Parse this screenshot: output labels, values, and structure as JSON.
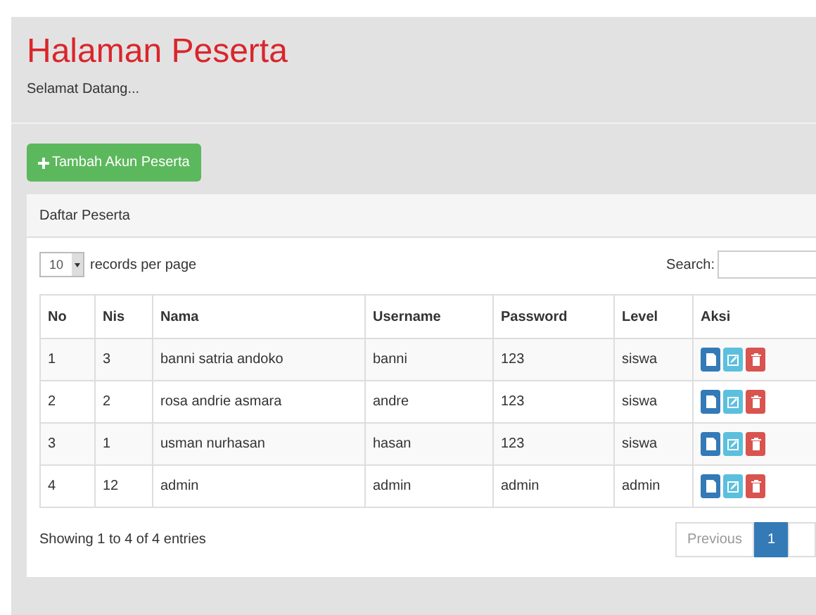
{
  "page": {
    "title": "Halaman Peserta",
    "subtitle": "Selamat Datang..."
  },
  "add_button": {
    "label": "Tambah Akun Peserta"
  },
  "panel": {
    "title": "Daftar Peserta"
  },
  "length_select": {
    "value": "10",
    "suffix": "records per page"
  },
  "search": {
    "label": "Search:"
  },
  "table": {
    "columns": [
      "No",
      "Nis",
      "Nama",
      "Username",
      "Password",
      "Level",
      "Aksi"
    ],
    "rows": [
      {
        "cells": [
          "1",
          "3",
          "banni satria andoko",
          "banni",
          "123",
          "siswa"
        ]
      },
      {
        "cells": [
          "2",
          "2",
          "rosa andrie asmara",
          "andre",
          "123",
          "siswa"
        ]
      },
      {
        "cells": [
          "3",
          "1",
          "usman nurhasan",
          "hasan",
          "123",
          "siswa"
        ]
      },
      {
        "cells": [
          "4",
          "12",
          "admin",
          "admin",
          "admin",
          "admin"
        ]
      }
    ]
  },
  "actions": [
    {
      "kind": "view"
    },
    {
      "kind": "edit"
    },
    {
      "kind": "delete"
    }
  ],
  "info": "Showing 1 to 4 of 4 entries",
  "pagination": [
    {
      "label": "Previous",
      "selected": false
    },
    {
      "label": "1",
      "selected": true
    },
    {
      "selected": false
    }
  ]
}
